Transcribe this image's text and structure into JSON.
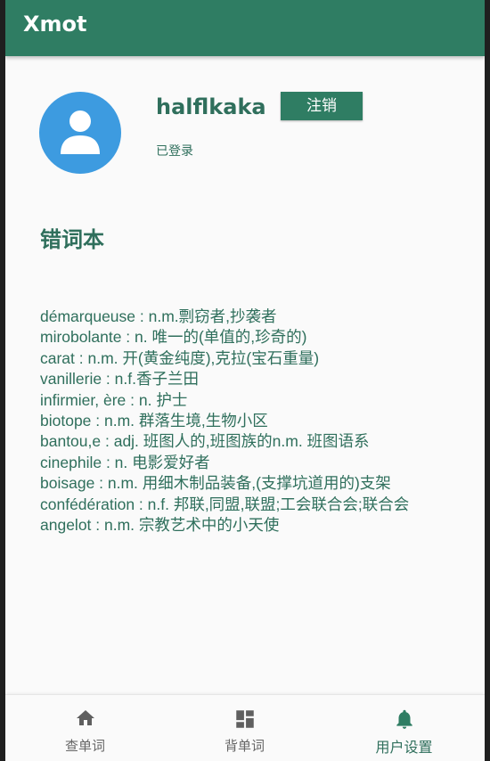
{
  "app": {
    "title": "Xmot"
  },
  "profile": {
    "username": "halflkaka",
    "logout_label": "注销",
    "status": "已登录"
  },
  "wordbook": {
    "title": "错词本",
    "entries": [
      "démarqueuse : n.m.剽窃者,抄袭者",
      "mirobolante : n. 唯一的(单值的,珍奇的)",
      "carat : n.m. 开(黄金纯度),克拉(宝石重量)",
      "vanillerie : n.f.香子兰田",
      "infirmier, ère : n. 护士",
      "biotope : n.m. 群落生境,生物小区",
      "bantou,e : adj. 班图人的,班图族的n.m. 班图语系",
      "cinephile : n. 电影爱好者",
      "boisage : n.m. 用细木制品装备,(支撑坑道用的)支架",
      "confédération : n.f. 邦联,同盟,联盟;工会联合会;联合会",
      "angelot : n.m. 宗教艺术中的小天使"
    ]
  },
  "nav": {
    "items": [
      {
        "label": "查单词",
        "icon": "home-icon"
      },
      {
        "label": "背单词",
        "icon": "dashboard-icon"
      },
      {
        "label": "用户设置",
        "icon": "bell-icon"
      }
    ],
    "active_index": 2
  },
  "colors": {
    "primary": "#2f7d63",
    "text": "#2f6f5c",
    "avatar": "#3d9be0"
  }
}
